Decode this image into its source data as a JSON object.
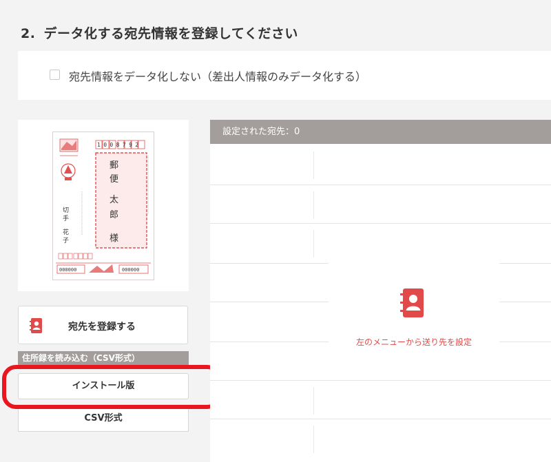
{
  "section": {
    "number": "2.",
    "title": "データ化する宛先情報を登録してください"
  },
  "option": {
    "checked": false,
    "label": "宛先情報をデータ化しない（差出人情報のみデータ化する）"
  },
  "postcard": {
    "postal_code": "1008792",
    "recipient_name": [
      "郵",
      "便",
      "太",
      "郎"
    ],
    "honorific": "様",
    "sender_name": [
      "切",
      "手",
      "花",
      "子"
    ],
    "amount_1": "000000",
    "amount_2": "000000"
  },
  "sidebar": {
    "register_button": "宛先を登録する",
    "csv_section_header": "住所録を読み込む（CSV形式）",
    "install_button": "インストール版",
    "csv_button": "CSV形式"
  },
  "destinations": {
    "header": "設定された宛先：0",
    "empty_message": "左のメニューから送り先を設定"
  },
  "colors": {
    "accent_red": "#e24a4a",
    "highlight_red": "#e8161e",
    "header_gray": "#a39e9c"
  }
}
